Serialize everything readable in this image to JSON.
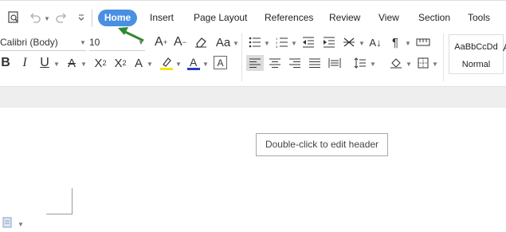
{
  "tabs": [
    "Home",
    "Insert",
    "Page Layout",
    "References",
    "Review",
    "View",
    "Section",
    "Tools"
  ],
  "font": {
    "name": "Calibri (Body)",
    "size": "10"
  },
  "style_gallery": {
    "sample": "AaBbCcDd",
    "name": "Normal"
  },
  "document": {
    "header_hint": "Double-click to edit header"
  },
  "colors": {
    "active_tab": "#4a90e2",
    "highlight": "#f5e400",
    "font_color": "#2b3cc4",
    "arrow": "#2e8b2e"
  },
  "icons": {
    "toolbar": [
      "print-preview-icon",
      "undo-icon",
      "redo-icon",
      "customize-icon"
    ],
    "format": [
      "bold-icon",
      "italic-icon",
      "underline-icon",
      "strikethrough-icon",
      "superscript-icon",
      "subscript-icon",
      "clear-formatting-icon",
      "highlight-icon",
      "font-color-icon",
      "character-shading-icon"
    ],
    "paragraph": [
      "bullets-icon",
      "numbering-icon",
      "decrease-indent-icon",
      "increase-indent-icon",
      "asian-layout-icon",
      "sort-icon",
      "show-marks-icon",
      "ruler-icon",
      "align-left-icon",
      "align-center-icon",
      "align-right-icon",
      "justify-icon",
      "distributed-icon",
      "line-spacing-icon",
      "shading-icon",
      "borders-icon"
    ]
  }
}
